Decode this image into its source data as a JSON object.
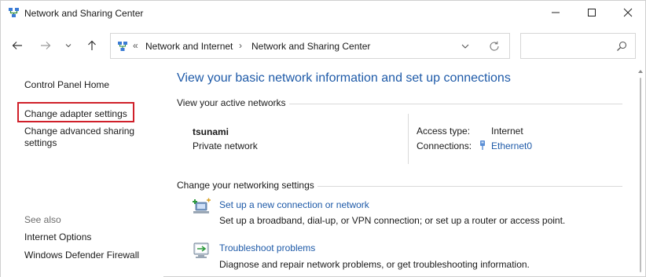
{
  "window": {
    "title": "Network and Sharing Center"
  },
  "address_bar": {
    "overflow_chevron": "«",
    "crumbs": [
      "Network and Internet",
      "Network and Sharing Center"
    ],
    "separator": "›"
  },
  "search": {
    "placeholder": ""
  },
  "left_pane": {
    "home": "Control Panel Home",
    "adapter": "Change adapter settings",
    "advanced": "Change advanced sharing settings",
    "see_also": "See also",
    "internet_options": "Internet Options",
    "defender_firewall": "Windows Defender Firewall"
  },
  "main": {
    "title": "View your basic network information and set up connections",
    "active_networks_label": "View your active networks",
    "network": {
      "name": "tsunami",
      "category": "Private network",
      "access_type_label": "Access type:",
      "access_type_value": "Internet",
      "connections_label": "Connections:",
      "connections_value": "Ethernet0"
    },
    "change_settings_label": "Change your networking settings",
    "tasks": [
      {
        "link": "Set up a new connection or network",
        "description": "Set up a broadband, dial-up, or VPN connection; or set up a router or access point."
      },
      {
        "link": "Troubleshoot problems",
        "description": "Diagnose and repair network problems, or get troubleshooting information."
      }
    ]
  },
  "colors": {
    "link": "#1e5aa8",
    "highlight_box": "#d0202a",
    "muted_text": "#6d6d6d"
  },
  "icons": {
    "app": "network-center-icon",
    "back": "arrow-left-icon",
    "forward": "arrow-right-icon",
    "recent": "chevron-down-icon",
    "up": "arrow-up-icon",
    "refresh": "refresh-icon",
    "search": "search-icon",
    "ethernet": "ethernet-icon",
    "new_connection": "new-connection-icon",
    "troubleshoot": "troubleshoot-icon"
  }
}
